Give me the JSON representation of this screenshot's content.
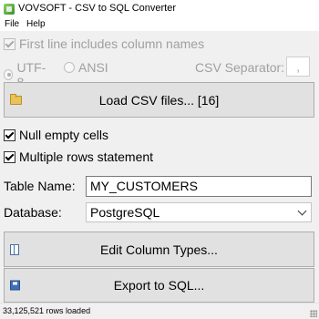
{
  "window": {
    "title": "VOVSOFT - CSV to SQL Converter",
    "icon": "app-icon"
  },
  "menu": {
    "items": [
      "File",
      "Help"
    ]
  },
  "options": {
    "first_line_header": {
      "label": "First line includes column names",
      "checked": true,
      "enabled": false
    },
    "encoding": {
      "selected": "UTF-8",
      "choices": [
        "UTF-8",
        "ANSI"
      ],
      "enabled": false
    },
    "csv_separator": {
      "label": "CSV Separator:",
      "value": ",",
      "enabled": false
    },
    "null_empty_cells": {
      "label": "Null empty cells",
      "checked": true
    },
    "multiple_rows": {
      "label": "Multiple rows statement",
      "checked": true
    }
  },
  "buttons": {
    "load_csv": {
      "label": "Load CSV files... [16]",
      "icon": "folder-icon"
    },
    "edit_column_types": {
      "label": "Edit Column Types...",
      "icon": "columns-icon"
    },
    "export_sql": {
      "label": "Export to SQL...",
      "icon": "save-icon"
    }
  },
  "fields": {
    "table_name": {
      "label": "Table Name:",
      "value": "MY_CUSTOMERS"
    },
    "database": {
      "label": "Database:",
      "value": "PostgreSQL"
    }
  },
  "status": {
    "text": "33,125,521 rows loaded"
  }
}
